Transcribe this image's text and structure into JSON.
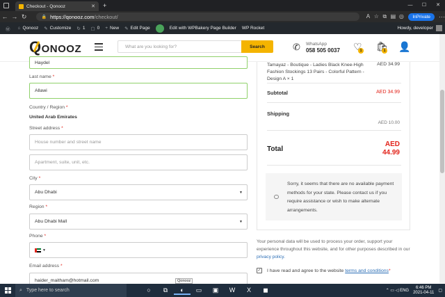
{
  "browser": {
    "tab_title": "Checkout - Qonooz",
    "url_domain": "https://qonooz.com",
    "url_path": "/checkout/",
    "inprivate_label": "InPrivate"
  },
  "wpbar": {
    "site_name": "Qonooz",
    "customize": "Customize",
    "updates_count": "1",
    "comments_count": "0",
    "new_label": "New",
    "edit_page": "Edit Page",
    "wpbakery": "Edit with WPBakery Page Builder",
    "wp_rocket": "WP Rocket",
    "howdy": "Howdy, developer"
  },
  "header": {
    "logo_text": "ONOOZ",
    "logo_q": "Q",
    "search_placeholder": "What are you looking for?",
    "search_button": "Search",
    "whatsapp_label": "WhatsApp",
    "whatsapp_number": "058 505 0037",
    "wishlist_count": "1",
    "cart_count": "1"
  },
  "form": {
    "first_name_value": "Haydel",
    "last_name_label": "Last name",
    "last_name_value": "Allawi",
    "country_label": "Country / Region",
    "country_value": "United Arab Emirates",
    "street_label": "Street address",
    "street_placeholder": "House number and street name",
    "apartment_placeholder": "Apartment, suite, unit, etc.",
    "city_label": "City",
    "city_value": "Abu Dhabi",
    "region_label": "Region",
    "region_value": "Abu Dhabi Mall",
    "phone_label": "Phone",
    "email_label": "Email address",
    "email_value": "haider_maitham@hotmail.com",
    "required_mark": "*"
  },
  "summary": {
    "product_name": "Tamayaz - Boutique - Ladies Black Knee-High Fashion Stockings 13 Pairs - Colorful Pattern - Design A",
    "product_qty": "× 1",
    "product_price": "AED 34.99",
    "subtotal_label": "Subtotal",
    "subtotal_value": "AED 34.99",
    "shipping_label": "Shipping",
    "shipping_value": "AED 10.00",
    "total_label": "Total",
    "total_currency": "AED",
    "total_amount": "44.99",
    "notice": "Sorry, it seems that there are no available payment methods for your state. Please contact us if you require assistance or wish to make alternate arrangements."
  },
  "privacy": {
    "text": "Your personal data will be used to process your order, support your experience throughout this website, and for other purposes described in our",
    "link": "privacy policy."
  },
  "terms": {
    "text": "I have read and agree to the website",
    "link": "terms and conditions",
    "required": "*"
  },
  "tooltip": "Qonooz",
  "taskbar": {
    "search_placeholder": "Type here to search",
    "lang": "ENG",
    "time": "6:46 PM",
    "date": "2021-04-11"
  },
  "colors": {
    "accent_yellow": "#f4b400",
    "price_red": "#e2231a",
    "valid_green": "#8fd16a",
    "link_blue": "#2a6db5"
  }
}
